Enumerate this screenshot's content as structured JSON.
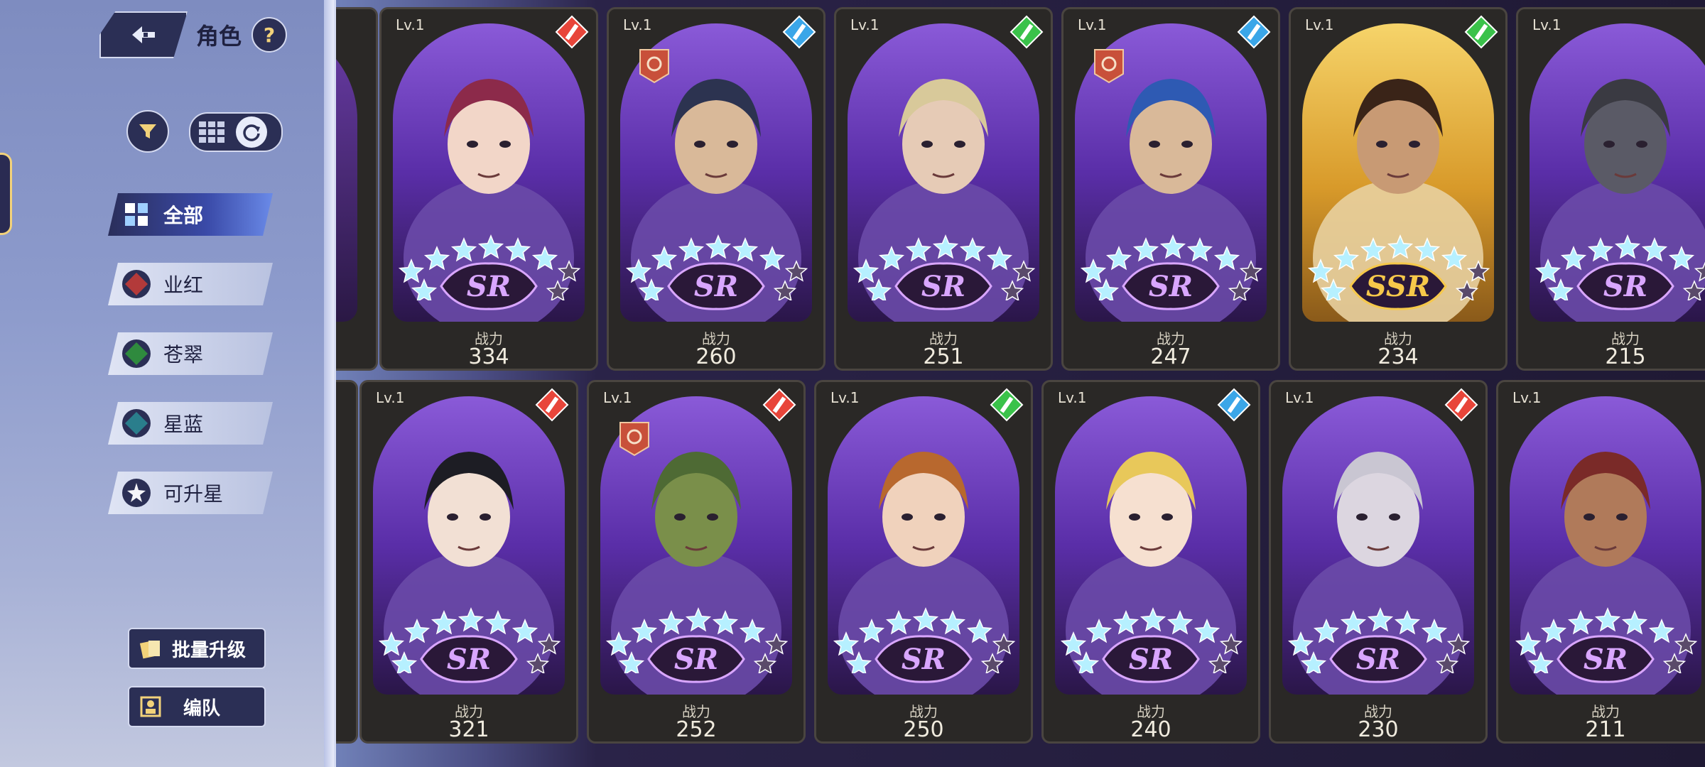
{
  "header": {
    "title": "角色",
    "help_label": "?"
  },
  "tabs": [
    {
      "label": "全部",
      "icon": "grid-squares-icon",
      "active": true
    },
    {
      "label": "业红",
      "icon": "red-diamond-icon",
      "color": "#b33a3a"
    },
    {
      "label": "苍翠",
      "icon": "green-diamond-icon",
      "color": "#2f8a3e"
    },
    {
      "label": "星蓝",
      "icon": "teal-diamond-icon",
      "color": "#2a7e8c"
    },
    {
      "label": "可升星",
      "icon": "star-sparkle-icon"
    }
  ],
  "actions": {
    "batch_upgrade": "批量升级",
    "formation": "编队"
  },
  "power_label": "战力",
  "cards": [
    {
      "lv": "Lv.1",
      "rarity": "SR",
      "power": "334",
      "element": "red",
      "element_icon": "flame-icon",
      "has_role": false,
      "theme": "purple",
      "hair": "#8c2a4a",
      "skin": "#f2d6c8"
    },
    {
      "lv": "Lv.1",
      "rarity": "SR",
      "power": "260",
      "element": "blue",
      "element_icon": "knife-icon",
      "has_role": true,
      "theme": "purple",
      "hair": "#2c3350",
      "skin": "#d9b999"
    },
    {
      "lv": "Lv.1",
      "rarity": "SR",
      "power": "251",
      "element": "green",
      "element_icon": "swirl-icon",
      "has_role": false,
      "theme": "purple",
      "hair": "#d8c99a",
      "skin": "#e6cbb6"
    },
    {
      "lv": "Lv.1",
      "rarity": "SR",
      "power": "247",
      "element": "blue",
      "element_icon": "sword-icon",
      "has_role": true,
      "theme": "purple",
      "hair": "#2e5ab3",
      "skin": "#d9b999"
    },
    {
      "lv": "Lv.1",
      "rarity": "SSR",
      "power": "234",
      "element": "green",
      "element_icon": "sword-icon",
      "has_role": false,
      "theme": "gold",
      "hair": "#3a2418",
      "skin": "#c89a74"
    },
    {
      "lv": "Lv.1",
      "rarity": "SR",
      "power": "215",
      "element": "none",
      "element_icon": "",
      "has_role": false,
      "theme": "purple",
      "hair": "#3a3a42",
      "skin": "#5a5a66"
    },
    {
      "lv": "Lv.1",
      "rarity": "SR",
      "power": "321",
      "element": "red",
      "element_icon": "gear-icon",
      "has_role": false,
      "theme": "purple",
      "hair": "#1d1d24",
      "skin": "#f2e0d4"
    },
    {
      "lv": "Lv.1",
      "rarity": "SR",
      "power": "252",
      "element": "red",
      "element_icon": "sword-icon",
      "has_role": true,
      "theme": "purple",
      "hair": "#4e6a34",
      "skin": "#7a8f4a"
    },
    {
      "lv": "Lv.1",
      "rarity": "SR",
      "power": "250",
      "element": "green",
      "element_icon": "sword-icon",
      "has_role": false,
      "theme": "purple",
      "hair": "#b8682e",
      "skin": "#f0d2bc"
    },
    {
      "lv": "Lv.1",
      "rarity": "SR",
      "power": "240",
      "element": "blue",
      "element_icon": "knife-icon",
      "has_role": false,
      "theme": "purple",
      "hair": "#e8c85a",
      "skin": "#f6e0d0"
    },
    {
      "lv": "Lv.1",
      "rarity": "SR",
      "power": "230",
      "element": "red",
      "element_icon": "swirl-icon",
      "has_role": false,
      "theme": "purple",
      "hair": "#c9c6d2",
      "skin": "#dcd6e0"
    },
    {
      "lv": "Lv.1",
      "rarity": "SR",
      "power": "211",
      "element": "none",
      "element_icon": "",
      "has_role": false,
      "theme": "purple",
      "hair": "#7a2a28",
      "skin": "#b07a5a"
    }
  ],
  "element_colors": {
    "red": "#e8453a",
    "blue": "#3aa6e8",
    "green": "#3ac24a"
  }
}
